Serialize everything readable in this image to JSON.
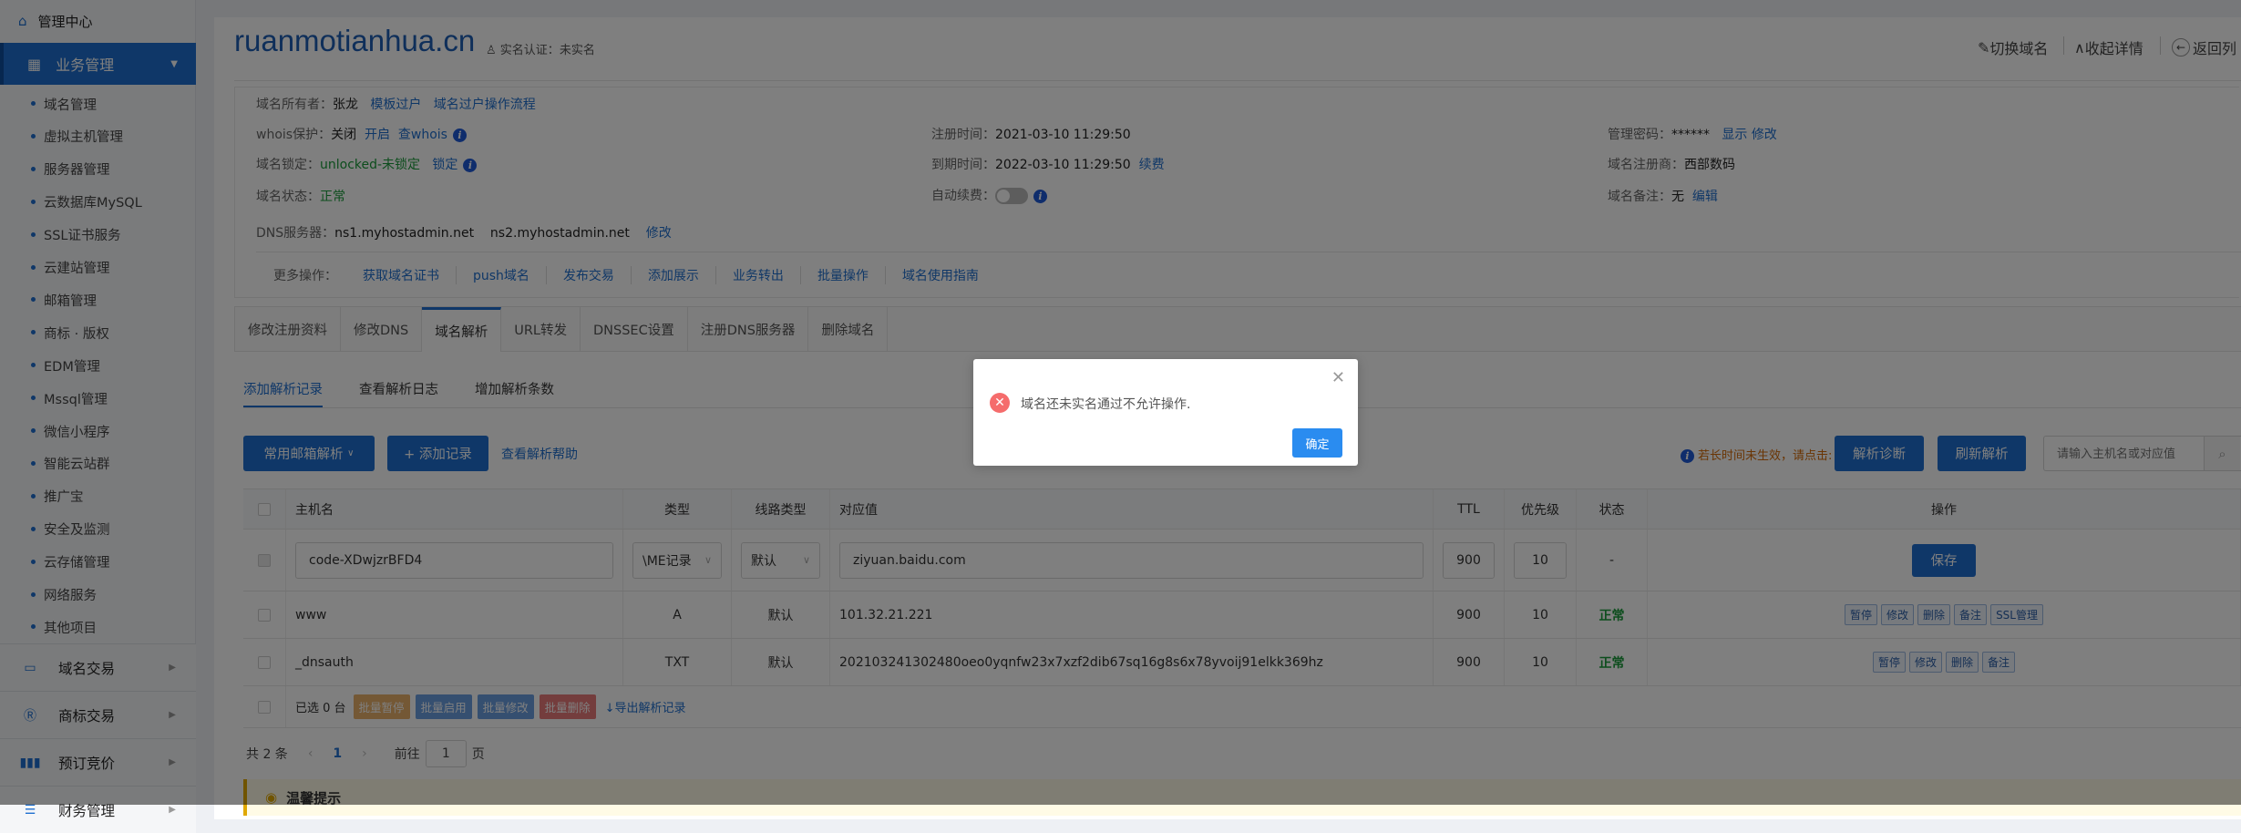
{
  "sidebar": {
    "home": "管理中心",
    "active_group": "业务管理",
    "sub_items": [
      "域名管理",
      "虚拟主机管理",
      "服务器管理",
      "云数据库MySQL",
      "SSL证书服务",
      "云建站管理",
      "邮箱管理",
      "商标 · 版权",
      "EDM管理",
      "Mssql管理",
      "微信小程序",
      "智能云站群",
      "推广宝",
      "安全及监测",
      "云存储管理",
      "网络服务",
      "其他项目"
    ],
    "sections": [
      "域名交易",
      "商标交易",
      "预订竞价",
      "财务管理"
    ]
  },
  "header": {
    "domain": "ruanmotianhua.cn",
    "realname_label": "实名认证：",
    "realname_value": "未实名",
    "switch_domain": "切换域名",
    "collapse": "收起详情",
    "back": "返回列"
  },
  "info": {
    "owner_label": "域名所有者：",
    "owner": "张龙",
    "template_transfer": "模板过户",
    "transfer_flow": "域名过户操作流程",
    "whois_label": "whois保护：",
    "whois_value": "关闭",
    "whois_enable": "开启",
    "whois_check": "查whois",
    "lock_label": "域名锁定：",
    "lock_value": "unlocked-未锁定",
    "lock_action": "锁定",
    "status_label": "域名状态：",
    "status_value": "正常",
    "dns_label": "DNS服务器：",
    "dns1": "ns1.myhostadmin.net",
    "dns2": "ns2.myhostadmin.net",
    "dns_edit": "修改",
    "reg_label": "注册时间：",
    "reg_time": "2021-03-10 11:29:50",
    "exp_label": "到期时间：",
    "exp_time": "2022-03-10 11:29:50",
    "renew": "续费",
    "auto_label": "自动续费：",
    "auto_renew_on": false,
    "pwd_label": "管理密码：",
    "pwd_value": "******",
    "pwd_show": "显示",
    "pwd_edit": "修改",
    "registrar_label": "域名注册商：",
    "registrar": "西部数码",
    "note_label": "域名备注：",
    "note_value": "无",
    "note_edit": "编辑",
    "more_label": "更多操作：",
    "more_ops": [
      "获取域名证书",
      "push域名",
      "发布交易",
      "添加展示",
      "业务转出",
      "批量操作",
      "域名使用指南"
    ]
  },
  "tabs": [
    "修改注册资料",
    "修改DNS",
    "域名解析",
    "URL转发",
    "DNSSEC设置",
    "注册DNS服务器",
    "删除域名"
  ],
  "subtabs": [
    "添加解析记录",
    "查看解析日志",
    "增加解析条数"
  ],
  "toolbar": {
    "mail_parse": "常用邮箱解析",
    "add_record": "+ 添加记录",
    "help": "查看解析帮助",
    "hint": "若长时间未生效，请点击:",
    "diagnose": "解析诊断",
    "refresh": "刷新解析",
    "search_placeholder": "请输入主机名或对应值"
  },
  "table": {
    "headers": [
      "主机名",
      "类型",
      "线路类型",
      "对应值",
      "TTL",
      "优先级",
      "状态",
      "操作"
    ],
    "edit_row": {
      "host": "code-XDwjzrBFD4",
      "type": "\\ME记录",
      "line": "默认",
      "value": "ziyuan.baidu.com",
      "ttl": "900",
      "priority": "10",
      "status": "-",
      "save": "保存"
    },
    "rows": [
      {
        "host": "www",
        "type": "A",
        "line": "默认",
        "value": "101.32.21.221",
        "ttl": "900",
        "priority": "10",
        "status": "正常",
        "actions": [
          "暂停",
          "修改",
          "删除",
          "备注",
          "SSL管理"
        ]
      },
      {
        "host": "_dnsauth",
        "type": "TXT",
        "line": "默认",
        "value": "202103241302480oeo0yqnfw23x7xzf2dib67sq16g8s6x78yvoij91elkk369hz",
        "ttl": "900",
        "priority": "10",
        "status": "正常",
        "actions": [
          "暂停",
          "修改",
          "删除",
          "备注"
        ]
      }
    ],
    "selected": "已选 0 台",
    "bulk": [
      "批量暂停",
      "批量启用",
      "批量修改",
      "批量删除"
    ],
    "export": "↓导出解析记录"
  },
  "pager": {
    "total": "共 2 条",
    "page": "1",
    "goto": "前往",
    "goto_value": "1",
    "unit": "页"
  },
  "tips": "温馨提示",
  "modal": {
    "message": "域名还未实名通过不允许操作.",
    "ok": "确定"
  }
}
